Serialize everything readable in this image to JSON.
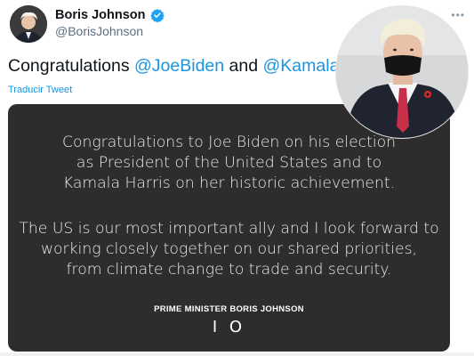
{
  "author": {
    "display_name": "Boris Johnson",
    "handle": "@BorisJohnson",
    "verified": true,
    "avatar_icon": "profile-photo"
  },
  "tweet": {
    "prefix": "Congratulations ",
    "mention_1": "@JoeBiden",
    "middle": " and ",
    "mention_2": "@KamalaHarris",
    "translate_label": "Traducir Tweet"
  },
  "statement": {
    "paragraph_1": [
      "Congratulations to Joe Biden on his election",
      "as President of the United States and to",
      "Kamala Harris on her historic achievement."
    ],
    "paragraph_2": [
      "The US is our most important ally and I look forward to",
      "working closely together on our shared priorities,",
      "from climate change to trade and security."
    ],
    "signature": "PRIME MINISTER BORIS JOHNSON",
    "mark": "I O"
  },
  "colors": {
    "mention": "#1b95e0",
    "verified_badge": "#1da1f2",
    "card_background": "#2f2d2c"
  }
}
